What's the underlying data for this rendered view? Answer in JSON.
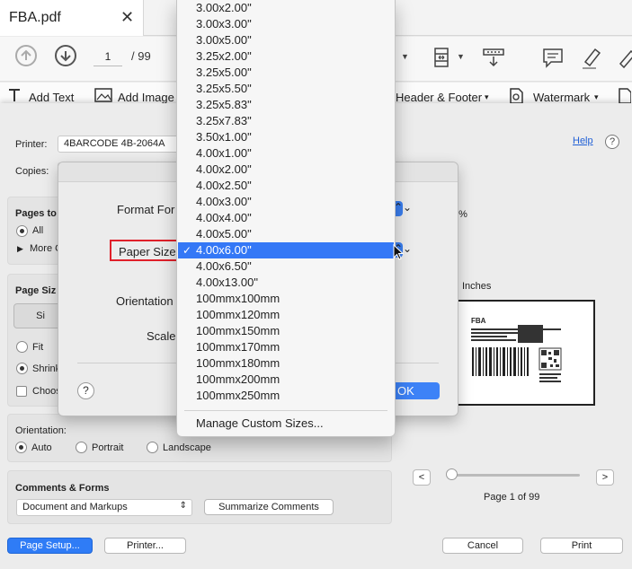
{
  "tab": {
    "title": "FBA.pdf",
    "close": "✕"
  },
  "toolbar": {
    "page_current": "1",
    "page_total": "/ 99"
  },
  "edit_toolbar": {
    "add_text": "Add Text",
    "add_image": "Add Image",
    "header_footer": "Header & Footer",
    "watermark": "Watermark",
    "caret": "▾"
  },
  "print_dialog": {
    "printer_label": "Printer:",
    "printer_value": "4BARCODE 4B-2064A",
    "copies_label": "Copies:",
    "help": "Help",
    "help_q": "?",
    "pages_to_print": "Pages to",
    "all": "All",
    "more": "More O",
    "page_sizing": "Page Siz",
    "size_btn": "Si",
    "fit": "Fit",
    "shrink": "Shrink",
    "choose": "Choos",
    "zoom": "0%",
    "inches": "Inches",
    "orientation_label": "Orientation:",
    "orientation_auto": "Auto",
    "orientation_portrait": "Portrait",
    "orientation_landscape": "Landscape",
    "comments_forms": "Comments & Forms",
    "comments_value": "Document and Markups",
    "summarize": "Summarize Comments",
    "page_setup": "Page Setup...",
    "printer_btn": "Printer...",
    "cancel": "Cancel",
    "print": "Print",
    "prev": "<",
    "next": ">",
    "page_indicator": "Page 1 of 99",
    "preview_header": "FBA"
  },
  "page_setup": {
    "format_for": "Format For",
    "paper_size": "Paper Size",
    "orientation": "Orientation",
    "scale": "Scale",
    "ok": "OK",
    "help_q": "?"
  },
  "paper_menu": {
    "items": [
      "3.00x2.00\"",
      "3.00x3.00\"",
      "3.00x5.00\"",
      "3.25x2.00\"",
      "3.25x5.00\"",
      "3.25x5.50\"",
      "3.25x5.83\"",
      "3.25x7.83\"",
      "3.50x1.00\"",
      "4.00x1.00\"",
      "4.00x2.00\"",
      "4.00x2.50\"",
      "4.00x3.00\"",
      "4.00x4.00\"",
      "4.00x5.00\"",
      "4.00x6.00\"",
      "4.00x6.50\"",
      "4.00x13.00\"",
      "100mmx100mm",
      "100mmx120mm",
      "100mmx150mm",
      "100mmx170mm",
      "100mmx180mm",
      "100mmx200mm",
      "100mmx250mm"
    ],
    "selected": "4.00x6.00\"",
    "check": "✓",
    "manage": "Manage Custom Sizes..."
  },
  "colors": {
    "accent": "#3478f6",
    "highlight_border": "#e0202a"
  }
}
